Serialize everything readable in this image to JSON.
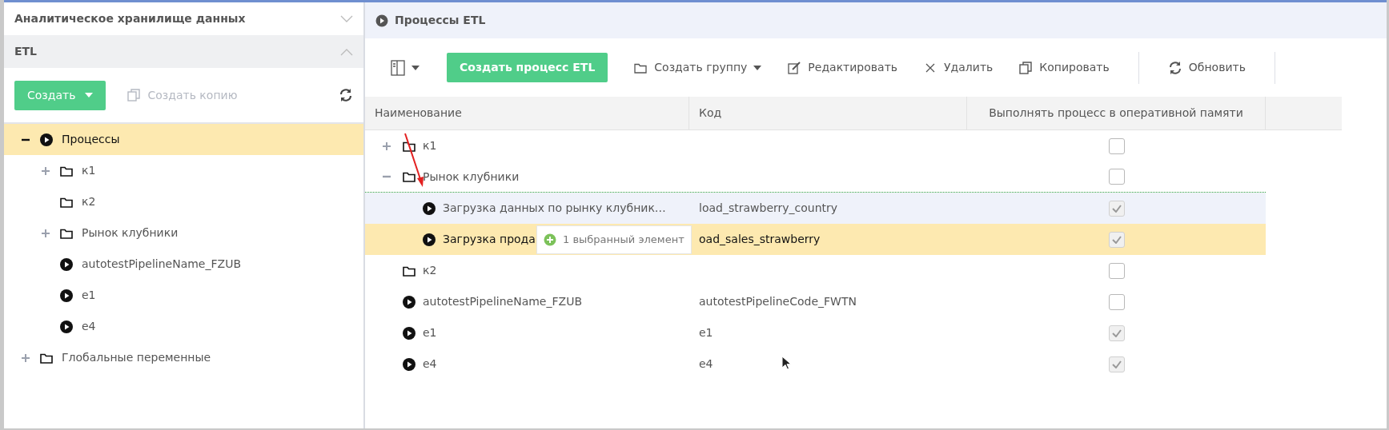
{
  "sidebar": {
    "sections": [
      {
        "title": "Аналитическое хранилище данных",
        "expanded": false
      },
      {
        "title": "ETL",
        "expanded": true
      }
    ],
    "toolbar": {
      "create": "Создать",
      "copy": {
        "label": "Создать копию",
        "disabled": true
      }
    },
    "tree": [
      {
        "label": "Процессы",
        "kind": "process",
        "expanded": true,
        "selected": true,
        "children": [
          {
            "label": "к1",
            "kind": "folder",
            "expanded": false,
            "selected": false
          },
          {
            "label": "к2",
            "kind": "folder",
            "selected": false
          },
          {
            "label": "Рынок клубники",
            "kind": "folder",
            "expanded": false,
            "selected": false
          },
          {
            "label": "autotestPipelineName_FZUB",
            "kind": "process",
            "selected": false
          },
          {
            "label": "e1",
            "kind": "process",
            "selected": false
          },
          {
            "label": "e4",
            "kind": "process",
            "selected": false
          }
        ]
      },
      {
        "label": "Глобальные переменные",
        "kind": "folder",
        "expanded": false,
        "selected": false
      }
    ]
  },
  "main": {
    "title": "Процессы ETL",
    "toolbar": [
      {
        "kind": "primary",
        "label": "Создать процесс ETL"
      },
      {
        "kind": "group",
        "label": "Создать группу"
      },
      {
        "kind": "edit",
        "label": "Редактировать"
      },
      {
        "kind": "delete",
        "label": "Удалить"
      },
      {
        "kind": "copy",
        "label": "Копировать"
      },
      {
        "kind": "refresh",
        "label": "Обновить"
      }
    ],
    "table": {
      "columns": [
        "Наименование",
        "Код",
        "Выполнять процесс в оперативной памяти"
      ],
      "rows": [
        {
          "name": "к1",
          "kind": "folder",
          "expanded": false,
          "code": "",
          "checked": false,
          "selected": false,
          "hovered": false,
          "drop_line": false
        },
        {
          "name": "Рынок клубники",
          "kind": "folder",
          "expanded": true,
          "code": "",
          "checked": false,
          "selected": false,
          "hovered": false,
          "drop_line": true,
          "children": [
            {
              "name": "Загрузка данных по рынку клубник…",
              "kind": "process",
              "code": "load_strawberry_country",
              "checked": true,
              "selected": false,
              "hovered": true,
              "drop_line": false
            },
            {
              "name": "Загрузка прода",
              "kind": "process",
              "code": "oad_sales_strawberry",
              "checked": true,
              "selected": true,
              "hovered": false,
              "drop_line": false
            }
          ]
        },
        {
          "name": "к2",
          "kind": "folder",
          "code": "",
          "checked": false,
          "selected": false,
          "hovered": false,
          "drop_line": false
        },
        {
          "name": "autotestPipelineName_FZUB",
          "kind": "process",
          "code": "autotestPipelineCode_FWTN",
          "checked": false,
          "selected": false,
          "hovered": false,
          "drop_line": false
        },
        {
          "name": "e1",
          "kind": "process",
          "code": "e1",
          "checked": true,
          "selected": false,
          "hovered": false,
          "drop_line": false
        },
        {
          "name": "e4",
          "kind": "process",
          "code": "e4",
          "checked": true,
          "selected": false,
          "hovered": false,
          "drop_line": false
        }
      ]
    },
    "drag_tooltip": {
      "text": "1 выбранный элемент"
    }
  }
}
